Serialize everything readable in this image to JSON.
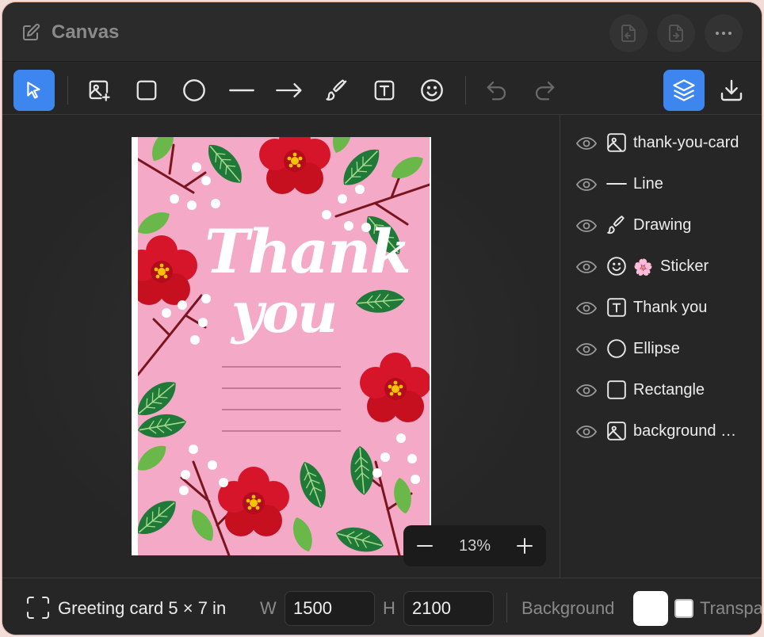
{
  "app": {
    "title": "Canvas"
  },
  "toolbar": {
    "tools": [
      "select-tool",
      "image-tool",
      "rectangle-tool",
      "ellipse-tool",
      "line-tool",
      "arrow-tool",
      "brush-tool",
      "text-tool",
      "sticker-tool"
    ],
    "actions": [
      "undo",
      "redo"
    ],
    "active_tool": "select-tool",
    "accent": "#3d86f0"
  },
  "card": {
    "line1": "Thank",
    "line2": "you",
    "background": "#f4aac6"
  },
  "zoom": {
    "value": "13%"
  },
  "layers": [
    {
      "name": "thank-you-card",
      "icon": "image-icon"
    },
    {
      "name": "Line",
      "icon": "line-icon"
    },
    {
      "name": "Drawing",
      "icon": "brush-icon"
    },
    {
      "name": "Sticker",
      "icon": "smiley-icon",
      "emoji": "🌸"
    },
    {
      "name": "Thank you",
      "icon": "text-icon"
    },
    {
      "name": "Ellipse",
      "icon": "ellipse-icon"
    },
    {
      "name": "Rectangle",
      "icon": "rectangle-icon"
    },
    {
      "name": "background …",
      "icon": "image-icon"
    }
  ],
  "bottom": {
    "preset": "Greeting card 5 × 7 in",
    "w_label": "W",
    "w_value": "1500",
    "h_label": "H",
    "h_value": "2100",
    "background_label": "Background",
    "transparent_label": "Transparent",
    "background_color": "#ffffff"
  }
}
